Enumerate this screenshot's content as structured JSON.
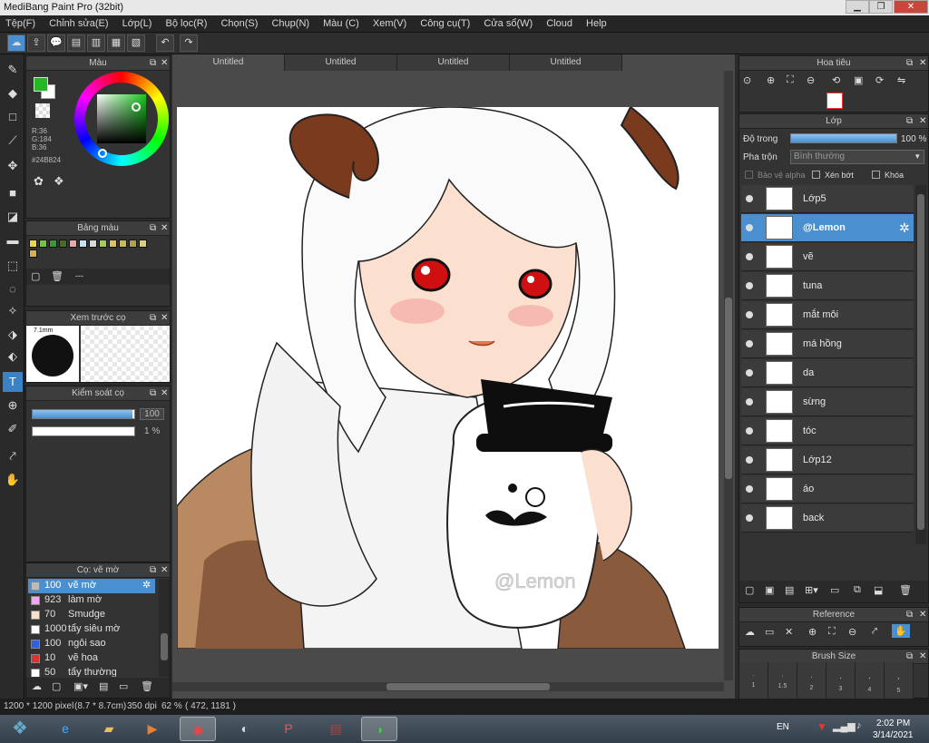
{
  "window": {
    "title": "MediBang Paint Pro (32bit)",
    "min": "▁",
    "max": "❐",
    "close": "✕"
  },
  "menu": [
    "Tệp(F)",
    "Chỉnh sửa(E)",
    "Lớp(L)",
    "Bộ lọc(R)",
    "Chọn(S)",
    "Chụp(N)",
    "Màu (C)",
    "Xem(V)",
    "Công cụ(T)",
    "Cửa sổ(W)",
    "Cloud",
    "Help"
  ],
  "color_panel": {
    "title": "Màu",
    "r": "R:36",
    "g": "G:184",
    "b": "B:36",
    "hex": "#24B824",
    "fg_color": "#24b824",
    "bg_color": "#ffffff"
  },
  "palette_panel": {
    "title": "Bảng màu",
    "empty_label": "---",
    "swatches": [
      "#e8d84a",
      "#7ac04a",
      "#3a9a3a",
      "#4a6a2a",
      "#e8a8a8",
      "#c8e0f0",
      "#d8d8d8",
      "#a8c860",
      "#e0c060",
      "#c8b860",
      "#b0a050",
      "#d8d080",
      "#d8b050"
    ]
  },
  "preview_panel": {
    "title": "Xem trước cọ",
    "size_label": "7.1mm"
  },
  "control_panel": {
    "title": "Kiểm soát cọ",
    "size_value": "100",
    "opacity_value": "1 %",
    "size_fraction": 0.98,
    "opacity_fraction": 1.0
  },
  "brush_panel": {
    "title": "Cọ: vẽ mờ",
    "brushes": [
      {
        "size": "100",
        "name": "vẽ mờ",
        "color": "#bbbbbb",
        "selected": true
      },
      {
        "size": "923",
        "name": "làm mờ",
        "color": "#f0a8f0",
        "selected": false
      },
      {
        "size": "70",
        "name": "Smudge",
        "color": "#f8e0c8",
        "selected": false
      },
      {
        "size": "1000",
        "name": "tẩy siêu mờ",
        "color": "#ffffff",
        "selected": false
      },
      {
        "size": "100",
        "name": "ngôi sao",
        "color": "#3060e0",
        "selected": false
      },
      {
        "size": "10",
        "name": "vẽ hoa",
        "color": "#e03030",
        "selected": false
      },
      {
        "size": "50",
        "name": "tẩy thường",
        "color": "#ffffff",
        "selected": false
      }
    ]
  },
  "tabs": [
    "Untitled",
    "Untitled",
    "Untitled",
    "Untitled"
  ],
  "canvas": {
    "watermark": "@Lemon"
  },
  "navigator_panel": {
    "title": "Hoa tiêu"
  },
  "layer_panel": {
    "title": "Lớp",
    "opacity_label": "Độ trong",
    "opacity_value": "100 %",
    "opacity_fraction": 1.0,
    "blend_label": "Pha trộn",
    "blend_value": "Bình thường",
    "protect_alpha": "Bảo vệ alpha",
    "clipping": "Xén bớt",
    "lock": "Khóa",
    "layers": [
      {
        "name": "Lớp5",
        "selected": false
      },
      {
        "name": "@Lemon",
        "selected": true
      },
      {
        "name": "vẽ",
        "selected": false
      },
      {
        "name": "tuna",
        "selected": false
      },
      {
        "name": "mắt môi",
        "selected": false
      },
      {
        "name": "má hồng",
        "selected": false
      },
      {
        "name": "da",
        "selected": false
      },
      {
        "name": "sừng",
        "selected": false
      },
      {
        "name": "tóc",
        "selected": false
      },
      {
        "name": "Lớp12",
        "selected": false
      },
      {
        "name": "áo",
        "selected": false
      },
      {
        "name": "back",
        "selected": false
      }
    ]
  },
  "reference_panel": {
    "title": "Reference"
  },
  "brushsize_panel": {
    "title": "Brush Size",
    "sizes": [
      "1",
      "1.5",
      "2",
      "3",
      "4",
      "5"
    ]
  },
  "status": {
    "dimensions": "1200 * 1200 pixel",
    "physical": "(8.7 * 8.7cm)",
    "dpi": "350 dpi",
    "zoom": "62 %",
    "coords": "( 472, 1181 )"
  },
  "taskbar": {
    "lang": "EN",
    "time": "2:02 PM",
    "date": "3/14/2021"
  }
}
